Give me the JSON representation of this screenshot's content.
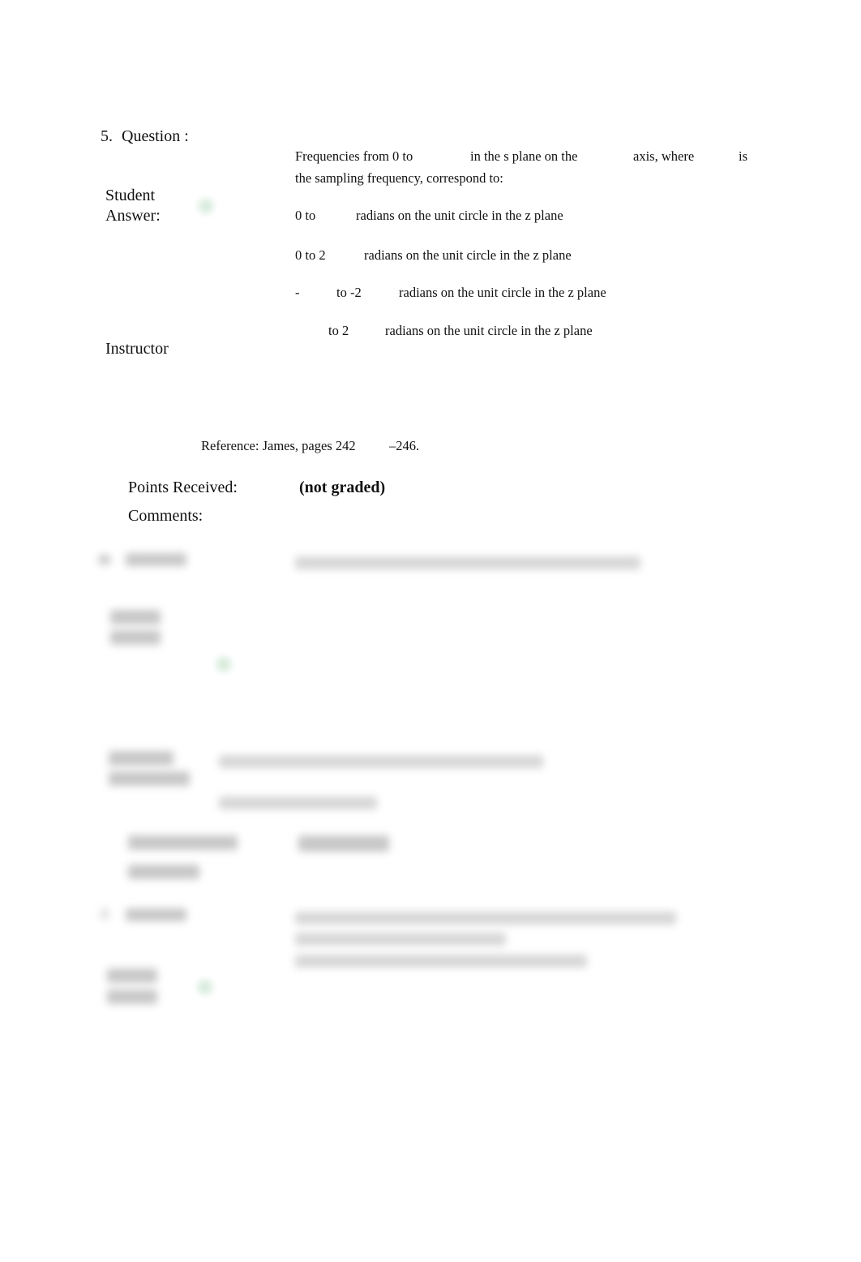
{
  "question5": {
    "number": "5.",
    "label": "Question :",
    "prompt_line1_parts": [
      "Frequencies from 0 to",
      "in the s plane on the",
      "axis, where",
      "is"
    ],
    "prompt_line2": "the sampling frequency, correspond to:",
    "student_answer_label_1": "Student",
    "student_answer_label_2": "Answer:",
    "options": [
      {
        "a": "0 to",
        "b": "radians on the unit circle in the z plane"
      },
      {
        "a": "0 to 2",
        "b": "radians on the unit circle in the z plane"
      },
      {
        "a": "-",
        "mid": "to -2",
        "b": "radians on the unit circle in the z plane"
      },
      {
        "a": "to 2",
        "b": "radians on the unit circle in the z plane"
      }
    ],
    "instructor_label": "Instructor",
    "reference_parts": [
      "Reference: James, pages 242",
      "–246."
    ],
    "points_label": "Points Received:",
    "points_value": "(not graded)",
    "comments_label": "Comments:",
    "selected_icon": "check-icon"
  },
  "blurred_sections": {
    "note": "Questions 6 and 7 are blurred/obscured in the screenshot"
  }
}
